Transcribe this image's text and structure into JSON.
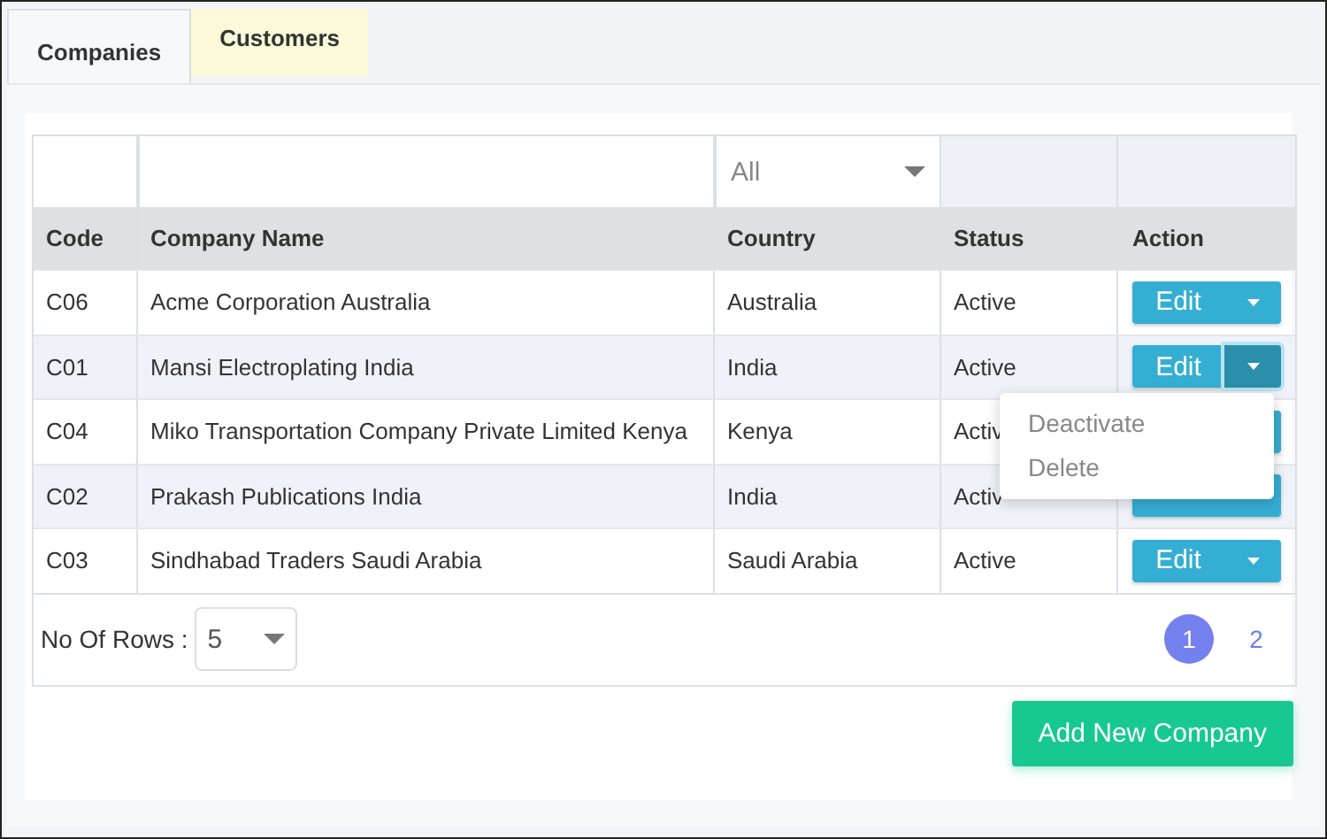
{
  "tabs": [
    {
      "label": "Companies",
      "selected": true
    },
    {
      "label": "Customers",
      "selected": false
    }
  ],
  "table": {
    "filters": {
      "country": "All"
    },
    "columns": [
      "Code",
      "Company Name",
      "Country",
      "Status",
      "Action"
    ],
    "rows": [
      {
        "code": "C06",
        "name": "Acme Corporation Australia",
        "country": "Australia",
        "status": "Active",
        "action": {
          "label": "Edit",
          "open": false
        }
      },
      {
        "code": "C01",
        "name": "Mansi Electroplating India",
        "country": "India",
        "status": "Active",
        "action": {
          "label": "Edit",
          "open": true,
          "menu": [
            "Deactivate",
            "Delete"
          ]
        }
      },
      {
        "code": "C04",
        "name": "Miko Transportation Company Private Limited Kenya",
        "country": "Kenya",
        "status": "Activ",
        "action": {
          "open": false
        }
      },
      {
        "code": "C02",
        "name": "Prakash Publications India",
        "country": "India",
        "status": "Activ",
        "action": {
          "open": false
        }
      },
      {
        "code": "C03",
        "name": "Sindhabad Traders Saudi Arabia",
        "country": "Saudi Arabia",
        "status": "Active",
        "action": {
          "label": "Edit",
          "open": false
        }
      }
    ]
  },
  "footer": {
    "rows_label": "No Of Rows :",
    "rows_value": "5",
    "pages": [
      {
        "label": "1",
        "selected": true
      },
      {
        "label": "2",
        "selected": false
      }
    ]
  },
  "add_button": "Add New Company"
}
